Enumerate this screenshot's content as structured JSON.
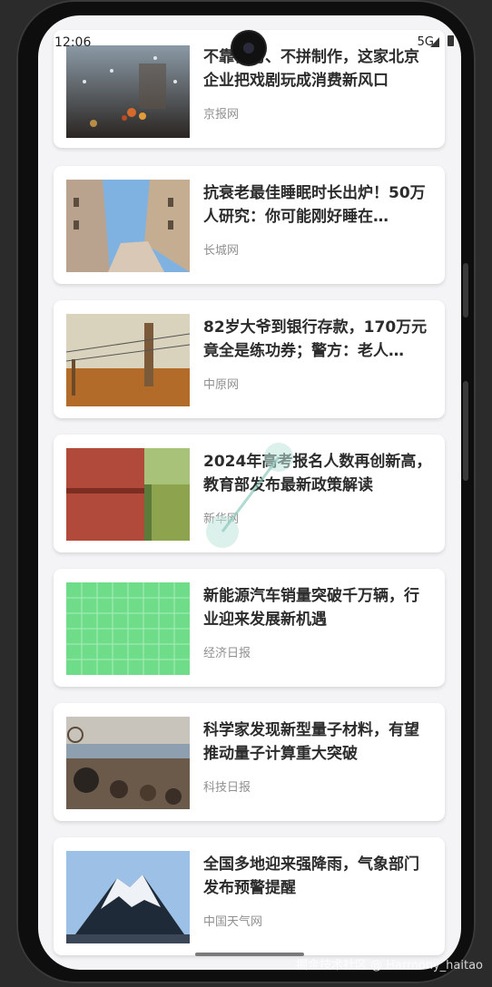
{
  "status_bar": {
    "time": "12:06",
    "network": "5G"
  },
  "news": [
    {
      "title": "不靠模仿、不拼制作，这家北京企业把戏剧玩成消费新风口",
      "source": "京报网"
    },
    {
      "title": "抗衰老最佳睡眠时长出炉！50万人研究：你可能刚好睡在…",
      "source": "长城网"
    },
    {
      "title": "82岁大爷到银行存款，170万元竟全是练功券；警方：老人…",
      "source": "中原网"
    },
    {
      "title": "2024年高考报名人数再创新高，教育部发布最新政策解读",
      "source": "新华网"
    },
    {
      "title": "新能源汽车销量突破千万辆，行业迎来发展新机遇",
      "source": "经济日报"
    },
    {
      "title": "科学家发现新型量子材料，有望推动量子计算重大突破",
      "source": "科技日报"
    },
    {
      "title": "全国多地迎来强降雨，气象部门发布预警提醒",
      "source": "中国天气网"
    }
  ],
  "watermark": "掘金技术社区 @ Harmony_haitao"
}
